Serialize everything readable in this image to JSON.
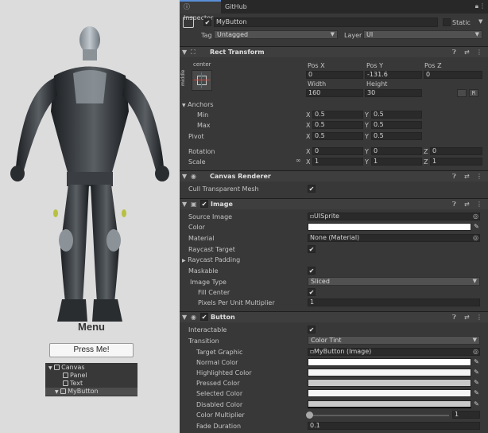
{
  "scene": {
    "menu_title": "Menu",
    "button_label": "Press Me!"
  },
  "hierarchy": [
    {
      "label": "Canvas"
    },
    {
      "label": "Panel"
    },
    {
      "label": "Text"
    },
    {
      "label": "MyButton"
    }
  ],
  "tabs": [
    "Inspector",
    "GitHub"
  ],
  "object": {
    "name": "MyButton",
    "static_label": "Static",
    "tag_label": "Tag",
    "tag_value": "Untagged",
    "layer_label": "Layer",
    "layer_value": "UI"
  },
  "rect_transform": {
    "title": "Rect Transform",
    "anchor_h": "center",
    "anchor_v": "middle",
    "pos_x_label": "Pos X",
    "pos_y_label": "Pos Y",
    "pos_z_label": "Pos Z",
    "pos_x": "0",
    "pos_y": "-131.6",
    "pos_z": "0",
    "width_label": "Width",
    "height_label": "Height",
    "width": "160",
    "height": "30",
    "r_button": "R",
    "anchors_label": "Anchors",
    "min_label": "Min",
    "max_label": "Max",
    "pivot_label": "Pivot",
    "min_x": "0.5",
    "min_y": "0.5",
    "max_x": "0.5",
    "max_y": "0.5",
    "pivot_x": "0.5",
    "pivot_y": "0.5",
    "rotation_label": "Rotation",
    "rot_x": "0",
    "rot_y": "0",
    "rot_z": "0",
    "scale_label": "Scale",
    "scale_x": "1",
    "scale_y": "1",
    "scale_z": "1",
    "x": "X",
    "y": "Y",
    "z": "Z"
  },
  "canvas_renderer": {
    "title": "Canvas Renderer",
    "cull_label": "Cull Transparent Mesh"
  },
  "image": {
    "title": "Image",
    "source_label": "Source Image",
    "source_value": "UISprite",
    "color_label": "Color",
    "color_value": "#ffffff",
    "material_label": "Material",
    "material_value": "None (Material)",
    "raycast_label": "Raycast Target",
    "padding_label": "Raycast Padding",
    "maskable_label": "Maskable",
    "type_label": "Image Type",
    "type_value": "Sliced",
    "fill_center_label": "Fill Center",
    "ppu_label": "Pixels Per Unit Multiplier",
    "ppu_value": "1"
  },
  "button": {
    "title": "Button",
    "interactable_label": "Interactable",
    "transition_label": "Transition",
    "transition_value": "Color Tint",
    "target_label": "Target Graphic",
    "target_value": "MyButton (Image)",
    "normal_label": "Normal Color",
    "normal_color": "#ffffff",
    "highlighted_label": "Highlighted Color",
    "highlighted_color": "#f5f5f5",
    "pressed_label": "Pressed Color",
    "pressed_color": "#c8c8c8",
    "selected_label": "Selected Color",
    "selected_color": "#f5f5f5",
    "disabled_label": "Disabled Color",
    "disabled_color": "#c8c8c8",
    "multiplier_label": "Color Multiplier",
    "multiplier_value": "1",
    "fade_label": "Fade Duration",
    "fade_value": "0.1"
  },
  "colors": {
    "accent": "#5a8fd8",
    "panel": "#383838",
    "header": "#3e3e3e",
    "field": "#2a2a2a"
  },
  "icons": [
    "info-icon",
    "lock-icon",
    "kebab-icon",
    "cube-icon",
    "checkbox-icon",
    "help-icon",
    "preset-icon",
    "eye-icon",
    "color-picker-icon",
    "object-target-icon",
    "constrain-proportions-icon",
    "anchor-preset-icon",
    "blueprint-icon",
    "image-component-icon",
    "button-component-icon",
    "foldout-arrow-icon"
  ]
}
